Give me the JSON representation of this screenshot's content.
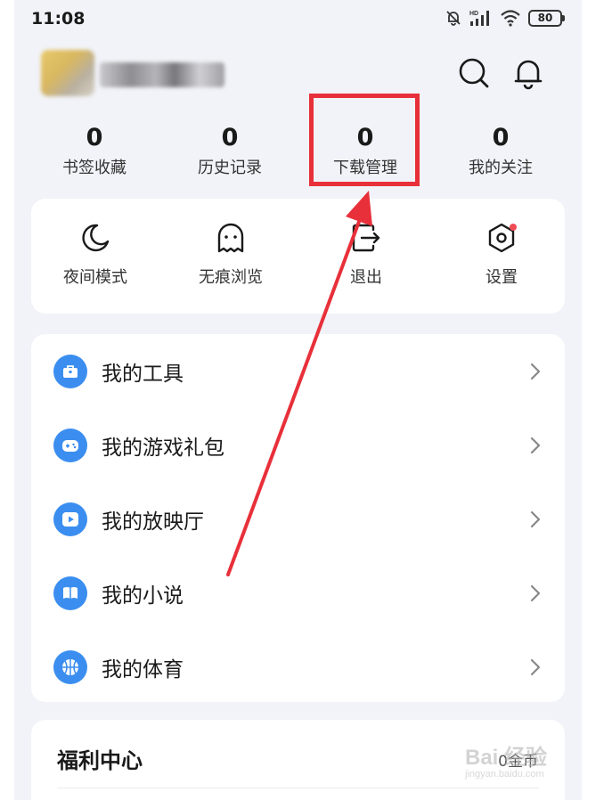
{
  "status_bar": {
    "time": "11:08",
    "network_label": "HD",
    "battery": "80"
  },
  "header": {
    "search_icon": "search-icon",
    "bell_icon": "bell-icon"
  },
  "stats": [
    {
      "value": "0",
      "label": "书签收藏"
    },
    {
      "value": "0",
      "label": "历史记录"
    },
    {
      "value": "0",
      "label": "下载管理"
    },
    {
      "value": "0",
      "label": "我的关注"
    }
  ],
  "quick_actions": [
    {
      "icon": "moon-icon",
      "label": "夜间模式"
    },
    {
      "icon": "ghost-icon",
      "label": "无痕浏览"
    },
    {
      "icon": "exit-icon",
      "label": "退出"
    },
    {
      "icon": "settings-icon",
      "label": "设置"
    }
  ],
  "menu": [
    {
      "icon": "toolbox-icon",
      "label": "我的工具"
    },
    {
      "icon": "gamepad-icon",
      "label": "我的游戏礼包"
    },
    {
      "icon": "play-icon",
      "label": "我的放映厅"
    },
    {
      "icon": "book-icon",
      "label": "我的小说"
    },
    {
      "icon": "basketball-icon",
      "label": "我的体育"
    }
  ],
  "welfare": {
    "title": "福利中心",
    "right_text": "0金币"
  },
  "watermark": {
    "logo": "Bai 经验",
    "url": "jingyan.baidu.com"
  },
  "colors": {
    "accent_blue": "#3b8ef0",
    "highlight_red": "#e8303a",
    "badge_red": "#f04b55",
    "background": "#f2f3f8"
  }
}
